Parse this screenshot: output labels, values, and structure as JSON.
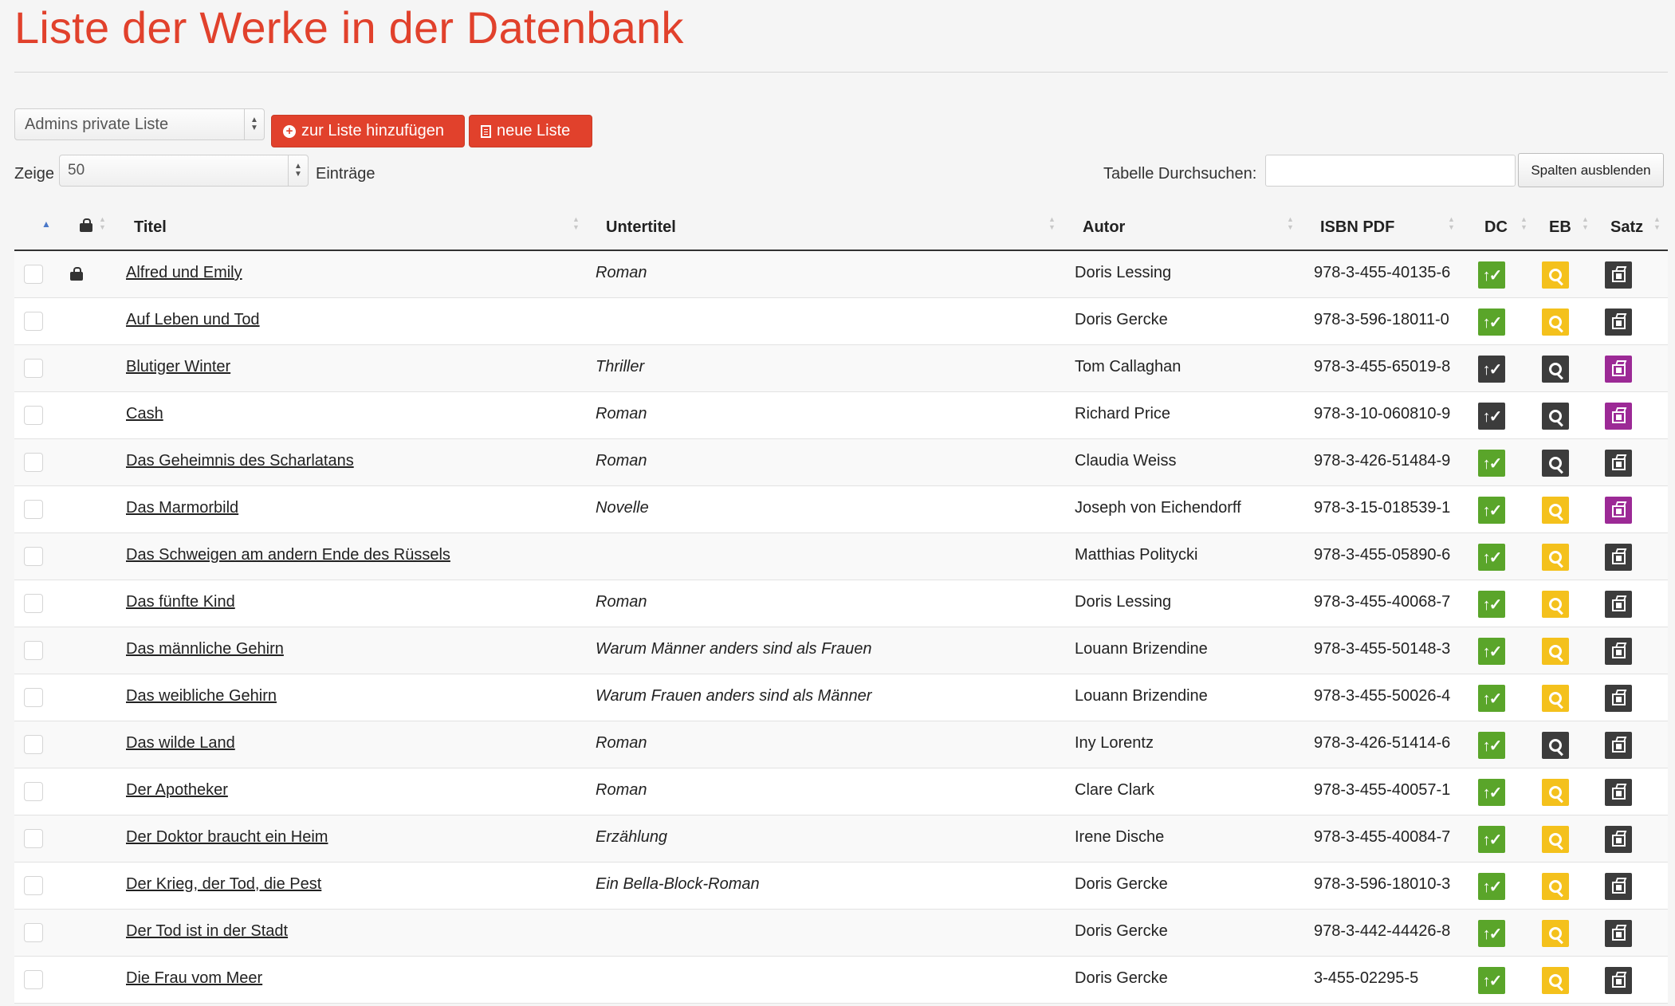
{
  "page_title": "Liste der Werke in der Datenbank",
  "list_select": {
    "value": "Admins private Liste"
  },
  "buttons": {
    "add_to_list": "zur Liste hinzufügen",
    "new_list": "neue Liste",
    "hide_columns": "Spalten ausblenden"
  },
  "length": {
    "prefix": "Zeige",
    "value": "50",
    "suffix": "Einträge"
  },
  "search": {
    "label": "Tabelle Durchsuchen:",
    "value": ""
  },
  "columns": {
    "title": "Titel",
    "subtitle": "Untertitel",
    "author": "Autor",
    "isbn": "ISBN PDF",
    "dc": "DC",
    "eb": "EB",
    "satz": "Satz"
  },
  "colors": {
    "accent": "#e1412c",
    "green": "#5aa52a",
    "yellow": "#f4c11c",
    "dark": "#3c3c3c",
    "purple": "#9c2a96"
  },
  "rows": [
    {
      "title": "Alfred und Emily",
      "subtitle": "Roman",
      "author": "Doris Lessing",
      "isbn": "978-3-455-40135-6",
      "locked": true,
      "dc": "green",
      "eb": "yellow",
      "satz": "dark"
    },
    {
      "title": "Auf Leben und Tod",
      "subtitle": "",
      "author": "Doris Gercke",
      "isbn": "978-3-596-18011-0",
      "locked": false,
      "dc": "green",
      "eb": "yellow",
      "satz": "dark"
    },
    {
      "title": "Blutiger Winter",
      "subtitle": "Thriller",
      "author": "Tom Callaghan",
      "isbn": "978-3-455-65019-8",
      "locked": false,
      "dc": "dark",
      "eb": "dark",
      "satz": "purple"
    },
    {
      "title": "Cash",
      "subtitle": "Roman",
      "author": "Richard Price",
      "isbn": "978-3-10-060810-9",
      "locked": false,
      "dc": "dark",
      "eb": "dark",
      "satz": "purple"
    },
    {
      "title": "Das Geheimnis des Scharlatans",
      "subtitle": "Roman",
      "author": "Claudia Weiss",
      "isbn": "978-3-426-51484-9",
      "locked": false,
      "dc": "green",
      "eb": "dark",
      "satz": "dark"
    },
    {
      "title": "Das Marmorbild",
      "subtitle": "Novelle",
      "author": "Joseph von Eichendorff",
      "isbn": "978-3-15-018539-1",
      "locked": false,
      "dc": "green",
      "eb": "yellow",
      "satz": "purple"
    },
    {
      "title": "Das Schweigen am andern Ende des Rüssels",
      "subtitle": "",
      "author": "Matthias Politycki",
      "isbn": "978-3-455-05890-6",
      "locked": false,
      "dc": "green",
      "eb": "yellow",
      "satz": "dark"
    },
    {
      "title": "Das fünfte Kind",
      "subtitle": "Roman",
      "author": "Doris Lessing",
      "isbn": "978-3-455-40068-7",
      "locked": false,
      "dc": "green",
      "eb": "yellow",
      "satz": "dark"
    },
    {
      "title": "Das männliche Gehirn",
      "subtitle": "Warum Männer anders sind als Frauen",
      "author": "Louann Brizendine",
      "isbn": "978-3-455-50148-3",
      "locked": false,
      "dc": "green",
      "eb": "yellow",
      "satz": "dark"
    },
    {
      "title": "Das weibliche Gehirn",
      "subtitle": "Warum Frauen anders sind als Männer",
      "author": "Louann Brizendine",
      "isbn": "978-3-455-50026-4",
      "locked": false,
      "dc": "green",
      "eb": "yellow",
      "satz": "dark"
    },
    {
      "title": "Das wilde Land",
      "subtitle": "Roman",
      "author": "Iny Lorentz",
      "isbn": "978-3-426-51414-6",
      "locked": false,
      "dc": "green",
      "eb": "dark",
      "satz": "dark"
    },
    {
      "title": "Der Apotheker",
      "subtitle": "Roman",
      "author": "Clare Clark",
      "isbn": "978-3-455-40057-1",
      "locked": false,
      "dc": "green",
      "eb": "yellow",
      "satz": "dark"
    },
    {
      "title": "Der Doktor braucht ein Heim",
      "subtitle": "Erzählung",
      "author": "Irene Dische",
      "isbn": "978-3-455-40084-7",
      "locked": false,
      "dc": "green",
      "eb": "yellow",
      "satz": "dark"
    },
    {
      "title": "Der Krieg, der Tod, die Pest",
      "subtitle": "Ein Bella-Block-Roman",
      "author": "Doris Gercke",
      "isbn": "978-3-596-18010-3",
      "locked": false,
      "dc": "green",
      "eb": "yellow",
      "satz": "dark"
    },
    {
      "title": "Der Tod ist in der Stadt",
      "subtitle": "",
      "author": "Doris Gercke",
      "isbn": "978-3-442-44426-8",
      "locked": false,
      "dc": "green",
      "eb": "yellow",
      "satz": "dark"
    },
    {
      "title": "Die Frau vom Meer",
      "subtitle": "",
      "author": "Doris Gercke",
      "isbn": "3-455-02295-5",
      "locked": false,
      "dc": "green",
      "eb": "yellow",
      "satz": "dark"
    }
  ]
}
